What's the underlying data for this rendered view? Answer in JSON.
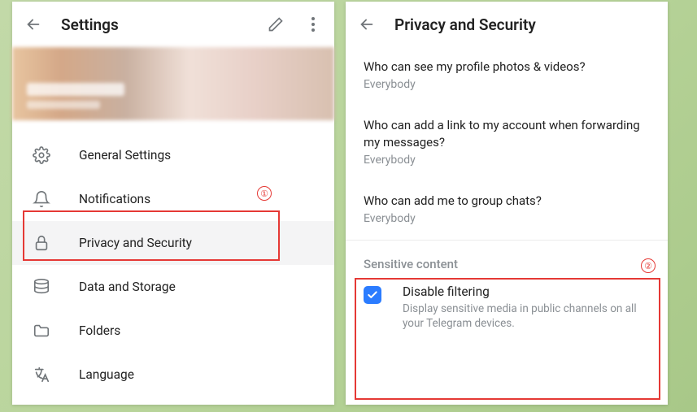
{
  "left": {
    "title": "Settings",
    "menu": [
      {
        "icon": "gear",
        "label": "General Settings"
      },
      {
        "icon": "bell",
        "label": "Notifications"
      },
      {
        "icon": "lock",
        "label": "Privacy and Security"
      },
      {
        "icon": "disk",
        "label": "Data and Storage"
      },
      {
        "icon": "folder",
        "label": "Folders"
      },
      {
        "icon": "lang",
        "label": "Language"
      }
    ]
  },
  "right": {
    "title": "Privacy and Security",
    "privacy": [
      {
        "q": "Who can see my profile photos & videos?",
        "a": "Everybody"
      },
      {
        "q": "Who can add a link to my account when forwarding my messages?",
        "a": "Everybody"
      },
      {
        "q": "Who can add me to group chats?",
        "a": "Everybody"
      }
    ],
    "sensitive": {
      "header": "Sensitive content",
      "title": "Disable filtering",
      "desc": "Display sensitive media in public channels on all your Telegram devices.",
      "checked": true
    }
  },
  "annotations": {
    "marker1": "①",
    "marker2": "②"
  }
}
